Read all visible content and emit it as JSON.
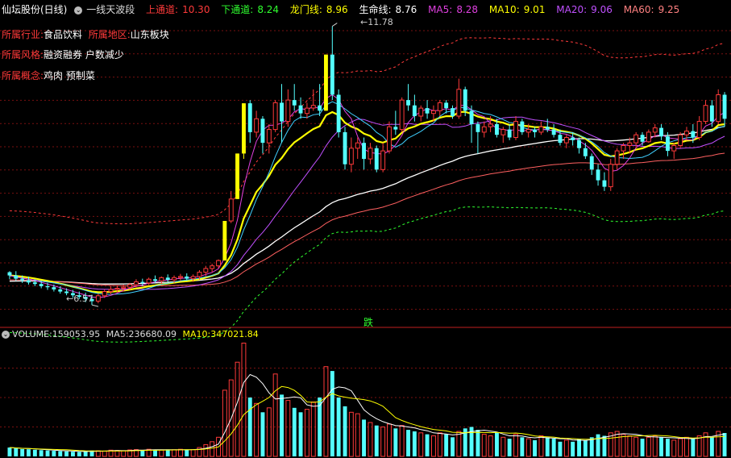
{
  "header": {
    "stock": "仙坛股份(日线)",
    "indicator": "一线天波段",
    "upper_label": "上通道:",
    "upper_value": "10.30",
    "lower_label": "下通道:",
    "lower_value": "8.24",
    "dragon_label": "龙门线:",
    "dragon_value": "8.96",
    "life_label": "生命线:",
    "life_value": "8.76",
    "ma5_label": "MA5:",
    "ma5_value": "8.28",
    "ma10_label": "MA10:",
    "ma10_value": "9.01",
    "ma20_label": "MA20:",
    "ma20_value": "9.06",
    "ma60_label": "MA60:",
    "ma60_value": "9.25"
  },
  "info": {
    "industry_label": "所属行业:",
    "industry_value": "食品饮料",
    "region_label": "所属地区:",
    "region_value": "山东板块",
    "style_label": "所属风格:",
    "style_value": "融资融券 户数减少",
    "concept_label": "所属概念:",
    "concept_value": "鸡肉 预制菜"
  },
  "annotations": {
    "high": "11.78",
    "low": "6.57",
    "signal": "跌"
  },
  "volume_header": {
    "label": "VOLUME:",
    "value": "159053.95",
    "ma5_label": "MA5:",
    "ma5_value": "236680.09",
    "ma10_label": "MA10:",
    "ma10_value": "347021.84"
  },
  "colors": {
    "up": "#ff3a3a",
    "down": "#54ffff",
    "limit_up": "#ffff00",
    "ma5": "#ffffff",
    "ma10": "#ffff00",
    "ma20": "#e040e0",
    "ma60": "#2fff2f",
    "upper": "#ff3a3a",
    "lower": "#2fff2f",
    "dragon": "#ffff00",
    "life": "#ffffff",
    "grid": "#7a1010"
  },
  "chart_data": {
    "type": "candlestick",
    "ylim": [
      6.3,
      12.0
    ],
    "grid": true,
    "candles": [
      [
        7.18,
        7.2,
        7.05,
        7.12
      ],
      [
        7.12,
        7.2,
        7.02,
        7.06
      ],
      [
        7.06,
        7.12,
        6.98,
        7.03
      ],
      [
        7.03,
        7.1,
        6.95,
        6.99
      ],
      [
        6.99,
        7.05,
        6.92,
        6.96
      ],
      [
        6.96,
        7.02,
        6.88,
        6.92
      ],
      [
        6.92,
        6.98,
        6.85,
        6.9
      ],
      [
        6.9,
        6.95,
        6.82,
        6.86
      ],
      [
        6.86,
        6.92,
        6.78,
        6.82
      ],
      [
        6.82,
        6.88,
        6.75,
        6.79
      ],
      [
        6.79,
        6.85,
        6.7,
        6.75
      ],
      [
        6.75,
        6.82,
        6.68,
        6.72
      ],
      [
        6.72,
        6.8,
        6.62,
        6.68
      ],
      [
        6.68,
        6.76,
        6.57,
        6.64
      ],
      [
        6.64,
        6.78,
        6.6,
        6.74
      ],
      [
        6.74,
        6.86,
        6.7,
        6.82
      ],
      [
        6.82,
        6.92,
        6.76,
        6.86
      ],
      [
        6.86,
        6.94,
        6.8,
        6.88
      ],
      [
        6.88,
        6.95,
        6.82,
        6.9
      ],
      [
        6.9,
        6.98,
        6.85,
        6.95
      ],
      [
        6.95,
        7.05,
        6.9,
        7.0
      ],
      [
        7.0,
        7.06,
        6.92,
        6.98
      ],
      [
        6.98,
        7.08,
        6.94,
        7.05
      ],
      [
        7.05,
        7.12,
        6.98,
        7.02
      ],
      [
        7.02,
        7.1,
        6.96,
        7.08
      ],
      [
        7.08,
        7.14,
        7.0,
        7.04
      ],
      [
        7.04,
        7.12,
        6.98,
        7.08
      ],
      [
        7.08,
        7.15,
        7.02,
        7.1
      ],
      [
        7.1,
        7.16,
        7.02,
        7.06
      ],
      [
        7.06,
        7.14,
        7.0,
        7.1
      ],
      [
        7.1,
        7.22,
        7.04,
        7.18
      ],
      [
        7.18,
        7.3,
        7.1,
        7.25
      ],
      [
        7.25,
        7.34,
        7.18,
        7.3
      ],
      [
        7.3,
        7.42,
        7.26,
        7.4
      ],
      [
        7.4,
        8.14,
        7.4,
        8.14
      ],
      [
        8.14,
        8.7,
        8.1,
        8.55
      ],
      [
        8.55,
        9.4,
        8.55,
        9.4
      ],
      [
        9.4,
        10.34,
        9.3,
        10.34
      ],
      [
        10.34,
        10.4,
        9.6,
        9.8
      ],
      [
        9.8,
        10.2,
        9.7,
        10.05
      ],
      [
        10.05,
        10.1,
        9.4,
        9.6
      ],
      [
        9.6,
        9.95,
        9.4,
        9.85
      ],
      [
        9.85,
        10.4,
        9.8,
        10.35
      ],
      [
        10.35,
        10.7,
        9.6,
        10.0
      ],
      [
        10.0,
        10.6,
        9.9,
        10.4
      ],
      [
        10.4,
        10.7,
        10.2,
        10.3
      ],
      [
        10.3,
        10.45,
        10.05,
        10.15
      ],
      [
        10.15,
        10.35,
        10.05,
        10.25
      ],
      [
        10.25,
        10.6,
        10.2,
        10.3
      ],
      [
        10.3,
        10.7,
        10.1,
        10.2
      ],
      [
        10.2,
        11.25,
        10.2,
        11.25
      ],
      [
        11.25,
        11.78,
        10.4,
        10.5
      ],
      [
        10.5,
        10.6,
        9.7,
        9.8
      ],
      [
        9.8,
        9.9,
        9.1,
        9.2
      ],
      [
        9.2,
        9.7,
        9.05,
        9.5
      ],
      [
        9.5,
        9.7,
        9.3,
        9.6
      ],
      [
        9.6,
        9.7,
        9.1,
        9.3
      ],
      [
        9.3,
        9.6,
        9.2,
        9.5
      ],
      [
        9.5,
        9.55,
        9.05,
        9.1
      ],
      [
        9.1,
        9.6,
        9.05,
        9.45
      ],
      [
        9.45,
        10.0,
        9.4,
        9.9
      ],
      [
        9.9,
        10.2,
        9.75,
        9.85
      ],
      [
        9.85,
        10.45,
        9.8,
        10.4
      ],
      [
        10.4,
        10.7,
        10.2,
        10.3
      ],
      [
        10.3,
        10.5,
        10.0,
        10.1
      ],
      [
        10.1,
        10.3,
        10.0,
        10.25
      ],
      [
        10.25,
        10.4,
        10.05,
        10.15
      ],
      [
        10.15,
        10.3,
        10.0,
        10.2
      ],
      [
        10.2,
        10.4,
        10.1,
        10.35
      ],
      [
        10.35,
        10.4,
        10.15,
        10.25
      ],
      [
        10.25,
        10.3,
        10.05,
        10.1
      ],
      [
        10.1,
        10.8,
        10.05,
        10.6
      ],
      [
        10.6,
        10.65,
        10.1,
        10.2
      ],
      [
        10.2,
        10.3,
        9.6,
        9.95
      ],
      [
        9.95,
        10.0,
        9.4,
        9.8
      ],
      [
        9.8,
        10.0,
        9.7,
        9.9
      ],
      [
        9.9,
        10.1,
        9.8,
        9.95
      ],
      [
        9.95,
        10.05,
        9.7,
        9.75
      ],
      [
        9.75,
        9.9,
        9.6,
        9.85
      ],
      [
        9.85,
        9.95,
        9.65,
        9.7
      ],
      [
        9.7,
        10.1,
        9.65,
        10.0
      ],
      [
        10.0,
        10.05,
        9.75,
        9.8
      ],
      [
        9.8,
        9.95,
        9.7,
        9.85
      ],
      [
        9.85,
        9.9,
        9.7,
        9.8
      ],
      [
        9.8,
        10.0,
        9.75,
        9.9
      ],
      [
        9.9,
        10.05,
        9.8,
        9.85
      ],
      [
        9.85,
        9.95,
        9.7,
        9.75
      ],
      [
        9.75,
        9.85,
        9.55,
        9.6
      ],
      [
        9.6,
        9.75,
        9.5,
        9.7
      ],
      [
        9.7,
        9.8,
        9.55,
        9.65
      ],
      [
        9.65,
        9.7,
        9.4,
        9.5
      ],
      [
        9.5,
        9.6,
        9.3,
        9.35
      ],
      [
        9.35,
        9.4,
        9.0,
        9.1
      ],
      [
        9.1,
        9.2,
        8.8,
        8.9
      ],
      [
        8.9,
        9.05,
        8.7,
        8.78
      ],
      [
        8.78,
        9.3,
        8.7,
        9.2
      ],
      [
        9.2,
        9.5,
        9.1,
        9.45
      ],
      [
        9.45,
        9.6,
        9.3,
        9.55
      ],
      [
        9.55,
        9.7,
        9.4,
        9.6
      ],
      [
        9.6,
        9.8,
        9.5,
        9.75
      ],
      [
        9.75,
        9.8,
        9.55,
        9.62
      ],
      [
        9.62,
        9.85,
        9.6,
        9.8
      ],
      [
        9.8,
        9.95,
        9.7,
        9.88
      ],
      [
        9.88,
        9.95,
        9.65,
        9.72
      ],
      [
        9.72,
        9.8,
        9.35,
        9.45
      ],
      [
        9.45,
        9.6,
        9.3,
        9.55
      ],
      [
        9.55,
        9.8,
        9.5,
        9.75
      ],
      [
        9.75,
        9.9,
        9.65,
        9.82
      ],
      [
        9.82,
        9.95,
        9.6,
        9.7
      ],
      [
        9.7,
        10.1,
        9.65,
        10.0
      ],
      [
        10.0,
        10.4,
        9.95,
        10.3
      ],
      [
        10.3,
        10.4,
        9.9,
        10.0
      ],
      [
        10.0,
        10.6,
        9.95,
        10.5
      ],
      [
        10.5,
        10.55,
        9.9,
        10.05
      ]
    ],
    "volume": {
      "ylim": [
        0,
        800000
      ],
      "values": [
        60000,
        55000,
        50000,
        48000,
        45000,
        42000,
        40000,
        38000,
        36000,
        34000,
        32000,
        30000,
        35000,
        40000,
        38000,
        36000,
        42000,
        40000,
        38000,
        44000,
        46000,
        42000,
        48000,
        45000,
        43000,
        47000,
        45000,
        48000,
        44000,
        46000,
        60000,
        80000,
        100000,
        130000,
        450000,
        520000,
        640000,
        770000,
        400000,
        360000,
        300000,
        330000,
        560000,
        420000,
        380000,
        330000,
        300000,
        320000,
        370000,
        400000,
        610000,
        580000,
        400000,
        340000,
        300000,
        290000,
        250000,
        230000,
        210000,
        200000,
        220000,
        190000,
        210000,
        180000,
        170000,
        160000,
        150000,
        140000,
        160000,
        150000,
        130000,
        170000,
        190000,
        200000,
        180000,
        150000,
        140000,
        160000,
        130000,
        120000,
        150000,
        130000,
        120000,
        110000,
        140000,
        130000,
        120000,
        100000,
        110000,
        100000,
        120000,
        110000,
        130000,
        150000,
        140000,
        160000,
        170000,
        150000,
        140000,
        130000,
        120000,
        130000,
        140000,
        130000,
        120000,
        110000,
        120000,
        130000,
        120000,
        140000,
        160000,
        130000,
        170000,
        159054
      ],
      "ma5_label_value": 236680.09,
      "ma10_label_value": 347021.84
    }
  }
}
